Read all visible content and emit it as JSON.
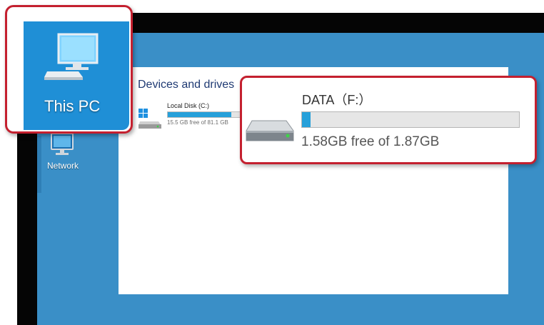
{
  "desktop": {
    "this_pc_label": "This PC",
    "network_label": "Network",
    "this_pc_icon": "computer-icon",
    "network_icon": "network-computer-icon"
  },
  "explorer": {
    "section_title": "Devices and drives",
    "drives": [
      {
        "name": "Local Disk (C:)",
        "free_text": "15.5 GB free of 81.1 GB",
        "used_fraction": 0.81,
        "icon": "windows-drive-icon"
      },
      {
        "name": "DATA（F:）",
        "free_text": "1.58GB free of 1.87GB",
        "used_fraction": 0.04,
        "icon": "hard-drive-icon"
      }
    ]
  },
  "colors": {
    "desktop_bg": "#3a8fc7",
    "tile_blue": "#1f8fd6",
    "highlight_red": "#c4202f",
    "usage_bar": "#26a0da"
  }
}
